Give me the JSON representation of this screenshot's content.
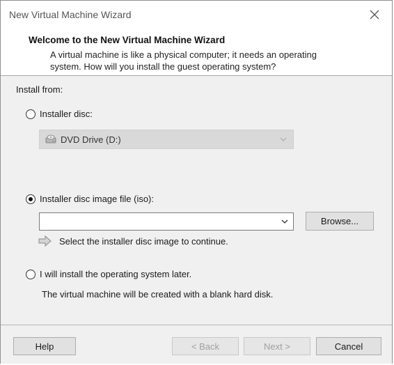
{
  "window": {
    "title": "New Virtual Machine Wizard"
  },
  "header": {
    "title": "Welcome to the New Virtual Machine Wizard",
    "description": "A virtual machine is like a physical computer; it needs an operating system. How will you install the guest operating system?"
  },
  "body": {
    "install_from_label": "Install from:",
    "options": {
      "installer_disc": {
        "label": "Installer disc:",
        "selected": false,
        "drive_value": "DVD Drive (D:)",
        "icon": "dvd-drive-icon"
      },
      "iso_file": {
        "label": "Installer disc image file (iso):",
        "selected": true,
        "value": "",
        "browse_label": "Browse...",
        "hint": "Select the installer disc image to continue.",
        "hint_icon": "arrow-right-icon"
      },
      "install_later": {
        "label": "I will install the operating system later.",
        "selected": false,
        "description": "The virtual machine will be created with a blank hard disk."
      }
    }
  },
  "footer": {
    "help_label": "Help",
    "back_label": "< Back",
    "next_label": "Next >",
    "cancel_label": "Cancel"
  },
  "colors": {
    "panel_bg": "#f0f0f0",
    "header_bg": "#ffffff",
    "button_bg": "#e1e1e1",
    "disabled_text": "#a0a0a0"
  }
}
